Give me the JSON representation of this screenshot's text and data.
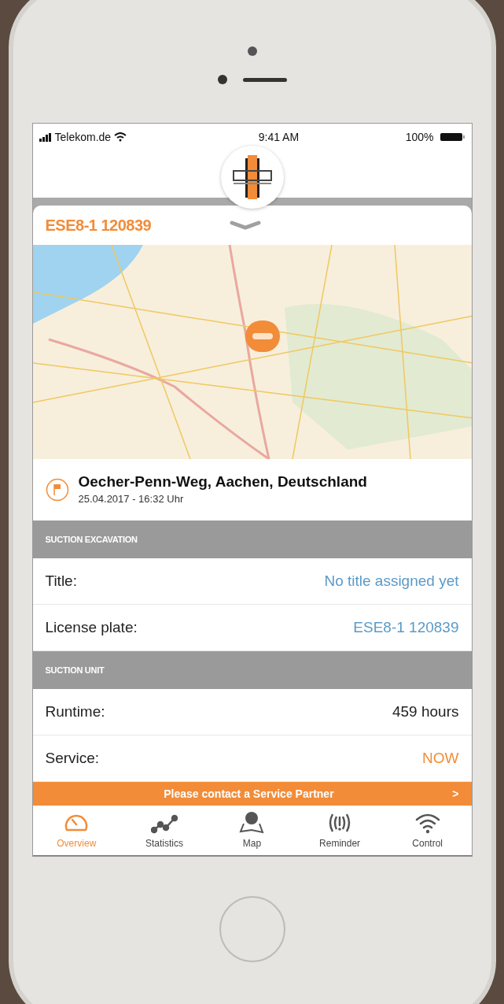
{
  "status_bar": {
    "carrier": "Telekom.de",
    "time": "9:41 AM",
    "battery": "100%"
  },
  "vehicle": {
    "id": "ESE8-1 120839"
  },
  "location": {
    "address": "Oecher-Penn-Weg, Aachen, Deutschland",
    "timestamp": "25.04.2017 - 16:32 Uhr"
  },
  "sections": [
    {
      "title": "SUCTION EXCAVATION",
      "rows": [
        {
          "label": "Title:",
          "value": "No title assigned yet",
          "kind": "link"
        },
        {
          "label": "License plate:",
          "value": "ESE8-1 120839",
          "kind": "link"
        }
      ]
    },
    {
      "title": "SUCTION UNIT",
      "rows": [
        {
          "label": "Runtime:",
          "value": "459 hours",
          "kind": "plain"
        },
        {
          "label": "Service:",
          "value": "NOW",
          "kind": "alert"
        }
      ]
    }
  ],
  "banner": {
    "text": "Please contact a Service Partner",
    "chevron": ">"
  },
  "tabs": [
    {
      "label": "Overview",
      "selected": true
    },
    {
      "label": "Statistics",
      "selected": false
    },
    {
      "label": "Map",
      "selected": false
    },
    {
      "label": "Reminder",
      "selected": false
    },
    {
      "label": "Control",
      "selected": false
    }
  ]
}
